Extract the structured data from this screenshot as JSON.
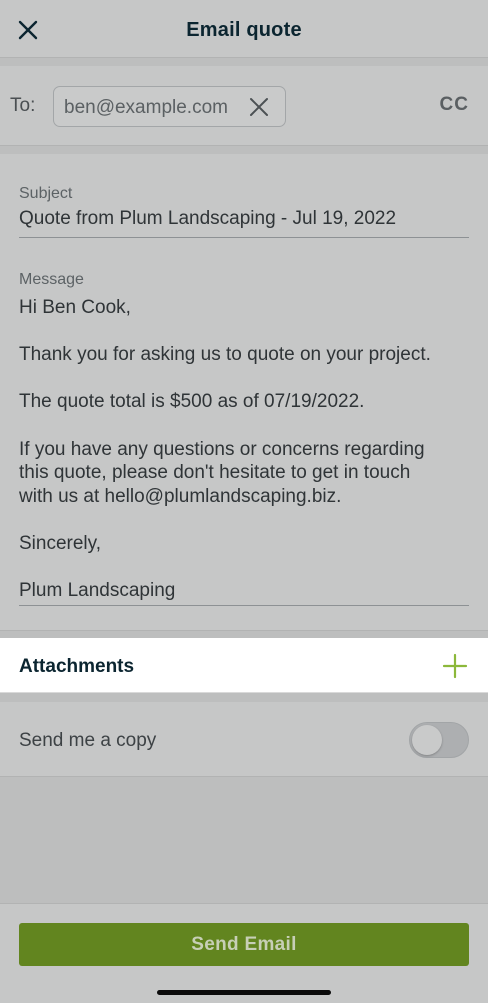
{
  "header": {
    "title": "Email quote",
    "close_icon": "close-icon"
  },
  "recipients": {
    "to_label": "To:",
    "email": "ben@example.com",
    "cc_label": "CC"
  },
  "subject": {
    "label": "Subject",
    "value": "Quote from Plum Landscaping - Jul 19, 2022"
  },
  "message": {
    "label": "Message",
    "lines": [
      "Hi Ben Cook,",
      "",
      "Thank you for asking us to quote on your project.",
      "",
      "The quote total is $500 as of 07/19/2022.",
      "",
      "If you have any questions or concerns regarding",
      "this quote, please don't hesitate to get in touch",
      "with us at hello@plumlandscaping.biz.",
      "",
      "Sincerely,",
      "",
      "Plum Landscaping"
    ]
  },
  "attachments": {
    "title": "Attachments",
    "add_icon": "plus-icon",
    "accent_color": "#8cb83a"
  },
  "copy": {
    "label": "Send me a copy",
    "enabled": false
  },
  "footer": {
    "send_label": "Send Email",
    "button_color": "#62851f"
  }
}
